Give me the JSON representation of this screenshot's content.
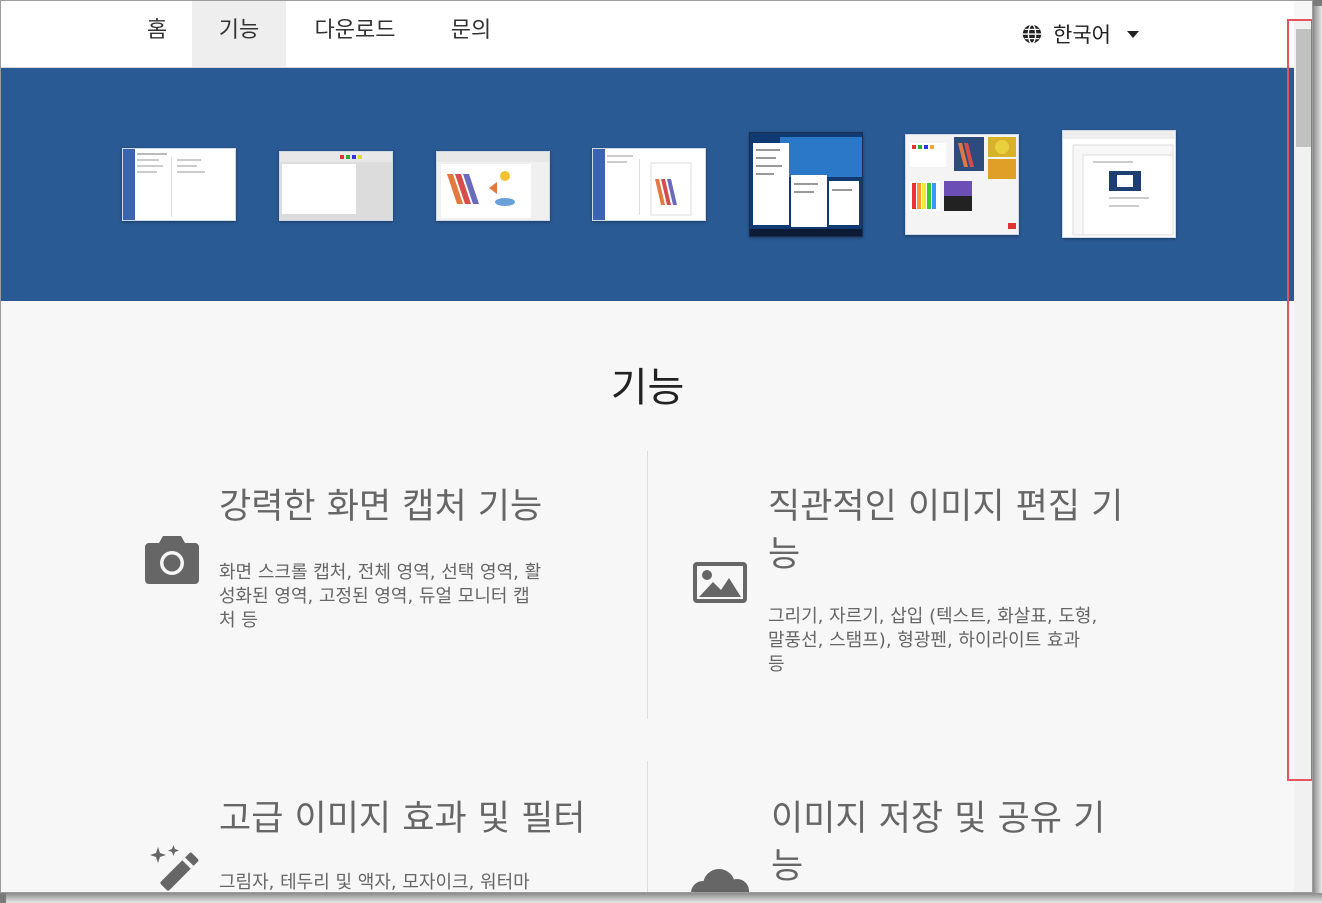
{
  "nav": {
    "items": [
      {
        "label": "홈"
      },
      {
        "label": "기능"
      },
      {
        "label": "다운로드"
      },
      {
        "label": "문의"
      }
    ],
    "active_index": 1,
    "language": "한국어"
  },
  "colors": {
    "banner": "#2a5a94",
    "highlight": "#e5555b",
    "icon": "#666666"
  },
  "section": {
    "title": "기능"
  },
  "features": [
    {
      "icon": "camera-icon",
      "title": "강력한 화면 캡처 기능",
      "desc_lines": [
        "화면 스크롤 캡처, 전체 영역, 선택 영역, 활",
        "성화된 영역, 고정된 영역, 듀얼 모니터 캡",
        "처 등"
      ]
    },
    {
      "icon": "image-icon",
      "title_lines": [
        "직관적인 이미지 편집 기",
        "능"
      ],
      "desc_lines": [
        "그리기, 자르기, 삽입 (텍스트, 화살표, 도형,",
        "말풍선, 스탬프), 형광펜, 하이라이트 효과",
        "등"
      ]
    },
    {
      "icon": "magic-wand-icon",
      "title": "고급 이미지 효과 및 필터",
      "desc_lines": [
        "그림자, 테두리 및 액자, 모자이크, 워터마"
      ]
    },
    {
      "icon": "cloud-icon",
      "title_lines": [
        "이미지 저장 및 공유 기",
        "능"
      ]
    }
  ]
}
